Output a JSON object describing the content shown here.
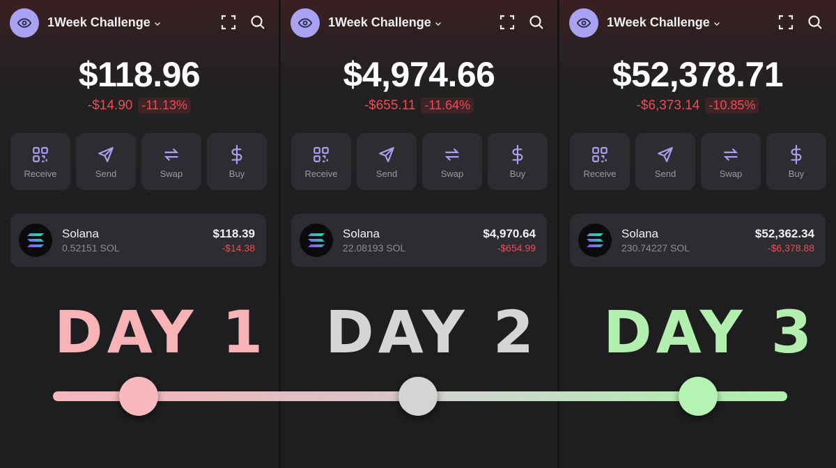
{
  "panels": [
    {
      "title": "1Week Challenge",
      "balance": "$118.96",
      "change_abs": "-$14.90",
      "change_pct": "-11.13%",
      "actions": [
        "Receive",
        "Send",
        "Swap",
        "Buy"
      ],
      "token": {
        "name": "Solana",
        "amount": "0.52151 SOL",
        "value": "$118.39",
        "change": "-$14.38"
      }
    },
    {
      "title": "1Week Challenge",
      "balance": "$4,974.66",
      "change_abs": "-$655.11",
      "change_pct": "-11.64%",
      "actions": [
        "Receive",
        "Send",
        "Swap",
        "Buy"
      ],
      "token": {
        "name": "Solana",
        "amount": "22.08193 SOL",
        "value": "$4,970.64",
        "change": "-$654.99"
      }
    },
    {
      "title": "1Week Challenge",
      "balance": "$52,378.71",
      "change_abs": "-$6,373.14",
      "change_pct": "-10.85%",
      "actions": [
        "Receive",
        "Send",
        "Swap",
        "Buy"
      ],
      "token": {
        "name": "Solana",
        "amount": "230.74227 SOL",
        "value": "$52,362.34",
        "change": "-$6,378.88"
      }
    }
  ],
  "days": [
    "DAY 1",
    "DAY 2",
    "DAY 3"
  ],
  "colors": {
    "accent": "#a9a1f2",
    "negative": "#ef4b57",
    "day1": "#f7b3b6",
    "day2": "#d5d5d5",
    "day3": "#b3f0b0"
  },
  "icons": [
    "eye-icon",
    "chevron-down-icon",
    "fullscreen-icon",
    "search-icon",
    "qr-code-icon",
    "send-icon",
    "swap-icon",
    "dollar-icon",
    "solana-logo"
  ]
}
